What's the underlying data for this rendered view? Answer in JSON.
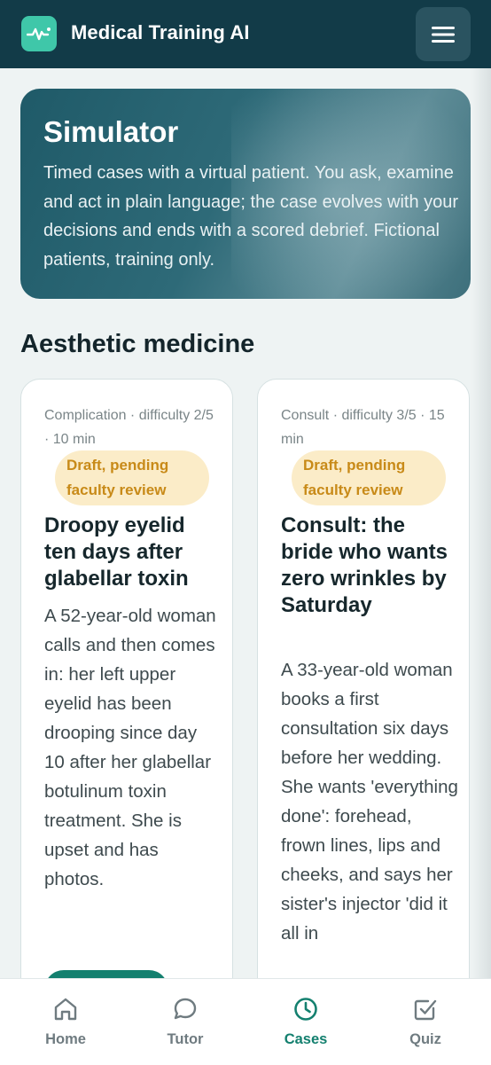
{
  "header": {
    "app_title": "Medical Training AI",
    "logo_icon": "pulse-icon",
    "menu_icon": "hamburger-menu-icon",
    "colors": {
      "bar": "#123b48",
      "logo": "#3fc7a9"
    }
  },
  "hero": {
    "title": "Simulator",
    "description": "Timed cases with a virtual patient. You ask, examine and act in plain language; the case evolves with your decisions and ends with a scored debrief. Fictional patients, training only."
  },
  "section": {
    "title": "Aesthetic medicine"
  },
  "cards": [
    {
      "meta": "Complication · difficulty 2/5 · 10 min",
      "badge": "Draft, pending faculty review",
      "title": "Droopy eyelid ten days after glabellar toxin",
      "description": "A 52-year-old woman calls and then comes in: her left upper eyelid has been drooping since day 10 after her glabellar botulinum toxin treatment. She is upset and has photos."
    },
    {
      "meta": "Consult · difficulty 3/5 · 15 min",
      "badge": "Draft, pending faculty review",
      "title": "Consult: the bride who wants zero wrinkles by Saturday",
      "description": "A 33-year-old woman books a first consultation six days before her wedding. She wants 'everything done': forehead, frown lines, lips and cheeks, and says her sister's injector 'did it all in"
    }
  ],
  "nav": {
    "items": [
      {
        "label": "Home",
        "icon": "home-icon",
        "active": false
      },
      {
        "label": "Tutor",
        "icon": "chat-bubble-icon",
        "active": false
      },
      {
        "label": "Cases",
        "icon": "clock-icon",
        "active": true
      },
      {
        "label": "Quiz",
        "icon": "checkbox-icon",
        "active": false
      }
    ],
    "active_color": "#14806f"
  }
}
